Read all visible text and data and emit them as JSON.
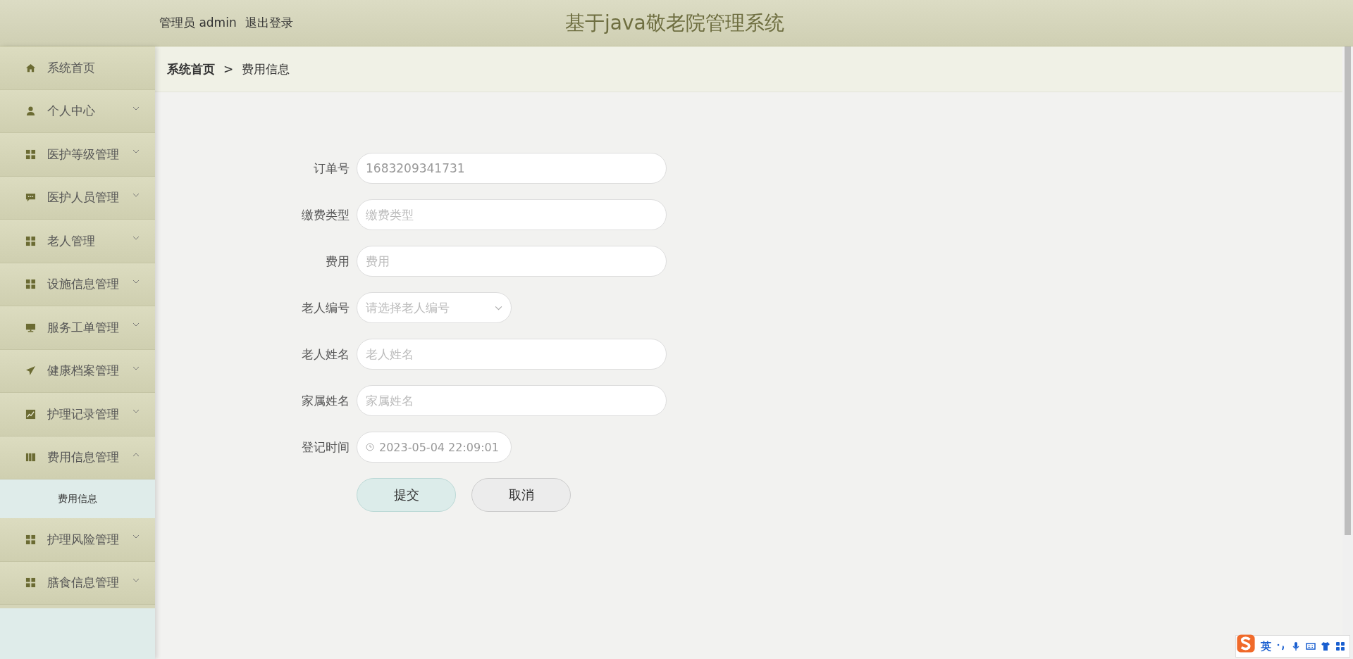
{
  "header": {
    "user_label": "管理员 admin",
    "logout": "退出登录",
    "title": "基于java敬老院管理系统"
  },
  "sidebar": {
    "items": [
      {
        "label": "系统首页",
        "kind": "link"
      },
      {
        "label": "个人中心",
        "kind": "menu",
        "expanded": false
      },
      {
        "label": "医护等级管理",
        "kind": "menu",
        "expanded": false
      },
      {
        "label": "医护人员管理",
        "kind": "menu",
        "expanded": false
      },
      {
        "label": "老人管理",
        "kind": "menu",
        "expanded": false
      },
      {
        "label": "设施信息管理",
        "kind": "menu",
        "expanded": false
      },
      {
        "label": "服务工单管理",
        "kind": "menu",
        "expanded": false
      },
      {
        "label": "健康档案管理",
        "kind": "menu",
        "expanded": false
      },
      {
        "label": "护理记录管理",
        "kind": "menu",
        "expanded": false
      },
      {
        "label": "费用信息管理",
        "kind": "menu",
        "expanded": true,
        "children": [
          {
            "label": "费用信息"
          }
        ]
      },
      {
        "label": "护理风险管理",
        "kind": "menu",
        "expanded": false
      },
      {
        "label": "膳食信息管理",
        "kind": "menu",
        "expanded": false
      }
    ]
  },
  "breadcrumb": {
    "home": "系统首页",
    "separator": ">",
    "current": "费用信息"
  },
  "form": {
    "fields": [
      {
        "label": "订单号",
        "kind": "text",
        "value": "1683209341731"
      },
      {
        "label": "缴费类型",
        "kind": "text",
        "placeholder": "缴费类型"
      },
      {
        "label": "费用",
        "kind": "text",
        "placeholder": "费用"
      },
      {
        "label": "老人编号",
        "kind": "select",
        "placeholder": "请选择老人编号"
      },
      {
        "label": "老人姓名",
        "kind": "text",
        "placeholder": "老人姓名"
      },
      {
        "label": "家属姓名",
        "kind": "text",
        "placeholder": "家属姓名"
      },
      {
        "label": "登记时间",
        "kind": "date",
        "value": "2023-05-04 22:09:01"
      }
    ],
    "buttons": [
      {
        "label": "提交",
        "kind": "primary"
      },
      {
        "label": "取消",
        "kind": "secondary"
      }
    ]
  },
  "ime_toolbar": {
    "language": "英"
  }
}
